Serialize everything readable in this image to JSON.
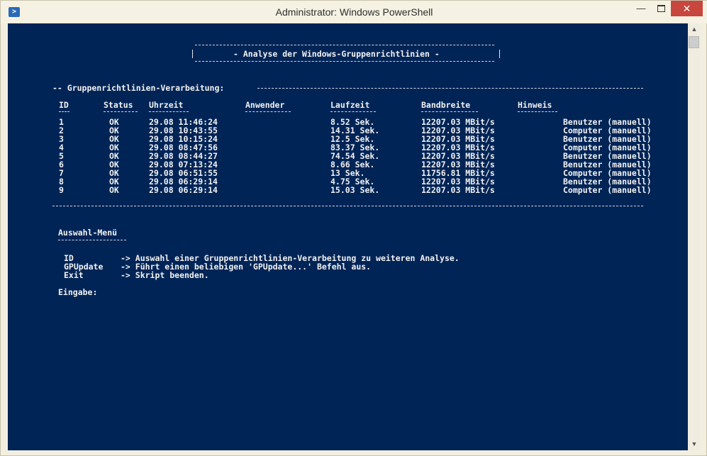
{
  "window": {
    "title": "Administrator: Windows PowerShell",
    "icon": "powershell-icon",
    "minimize": "—",
    "close": "✕"
  },
  "banner": {
    "text": "- Analyse der Windows-Gruppenrichtlinien -"
  },
  "section": {
    "heading": "-- Gruppenrichtlinien-Verarbeitung:"
  },
  "table": {
    "headers": [
      "ID",
      "Status",
      "Uhrzeit",
      "Anwender",
      "Laufzeit",
      "Bandbreite",
      "Hinweis"
    ],
    "rows": [
      {
        "id": "1",
        "status": "OK",
        "time": "29.08 11:46:24",
        "user": "",
        "runtime": "8.52 Sek.",
        "bandwidth": "12207.03 MBit/s",
        "note": "Benutzer (manuell)"
      },
      {
        "id": "2",
        "status": "OK",
        "time": "29.08 10:43:55",
        "user": "",
        "runtime": "14.31 Sek.",
        "bandwidth": "12207.03 MBit/s",
        "note": "Computer (manuell)"
      },
      {
        "id": "3",
        "status": "OK",
        "time": "29.08 10:15:24",
        "user": "",
        "runtime": "12.5 Sek.",
        "bandwidth": "12207.03 MBit/s",
        "note": "Benutzer (manuell)"
      },
      {
        "id": "4",
        "status": "OK",
        "time": "29.08 08:47:56",
        "user": "",
        "runtime": "83.37 Sek.",
        "bandwidth": "12207.03 MBit/s",
        "note": "Computer (manuell)"
      },
      {
        "id": "5",
        "status": "OK",
        "time": "29.08 08:44:27",
        "user": "",
        "runtime": "74.54 Sek.",
        "bandwidth": "12207.03 MBit/s",
        "note": "Benutzer (manuell)"
      },
      {
        "id": "6",
        "status": "OK",
        "time": "29.08 07:13:24",
        "user": "",
        "runtime": "8.66 Sek.",
        "bandwidth": "12207.03 MBit/s",
        "note": "Benutzer (manuell)"
      },
      {
        "id": "7",
        "status": "OK",
        "time": "29.08 06:51:55",
        "user": "",
        "runtime": "13 Sek.",
        "bandwidth": "11756.81 MBit/s",
        "note": "Computer (manuell)"
      },
      {
        "id": "8",
        "status": "OK",
        "time": "29.08 06:29:14",
        "user": "",
        "runtime": "4.75 Sek.",
        "bandwidth": "12207.03 MBit/s",
        "note": "Benutzer (manuell)"
      },
      {
        "id": "9",
        "status": "OK",
        "time": "29.08 06:29:14",
        "user": "",
        "runtime": "15.03 Sek.",
        "bandwidth": "12207.03 MBit/s",
        "note": "Computer (manuell)"
      }
    ]
  },
  "menu": {
    "title": "Auswahl-Menü",
    "items": [
      {
        "key": "ID",
        "desc": "-> Auswahl einer Gruppenrichtlinien-Verarbeitung zu weiteren Analyse."
      },
      {
        "key": "GPUpdate",
        "desc": "-> Führt einen beliebigen 'GPUpdate...' Befehl aus."
      },
      {
        "key": "Exit",
        "desc": "-> Skript beenden."
      }
    ],
    "prompt": "Eingabe:"
  },
  "scrollbar": {
    "up": "▲",
    "down": "▼"
  }
}
